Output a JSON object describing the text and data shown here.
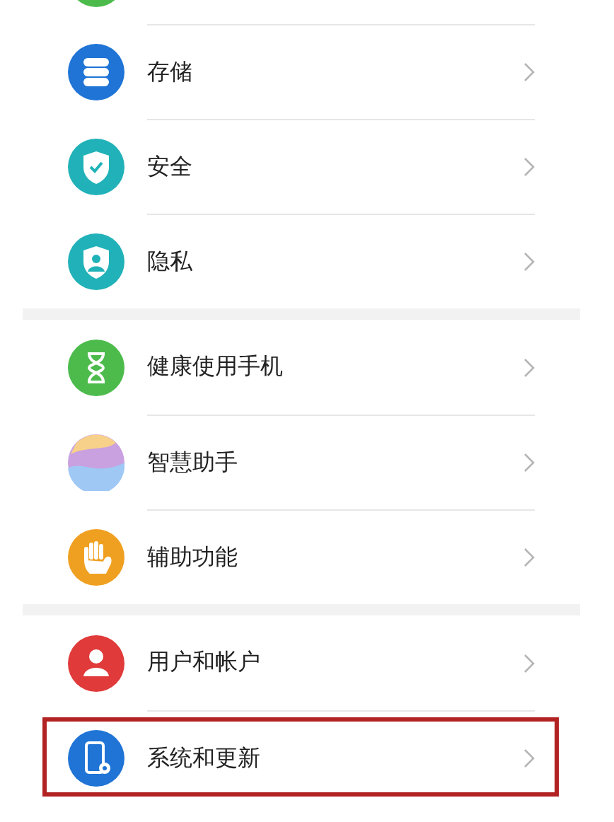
{
  "groups": [
    {
      "items": [
        {
          "kind": "cut",
          "color": "#4cbb4c"
        },
        {
          "kind": "row",
          "label": "存储",
          "color": "#1f74d6",
          "highlighted": false
        },
        {
          "kind": "row",
          "label": "安全",
          "color": "#20b2b8",
          "highlighted": false
        },
        {
          "kind": "row",
          "label": "隐私",
          "color": "#20b2b8",
          "highlighted": false
        }
      ]
    },
    {
      "items": [
        {
          "kind": "row",
          "label": "健康使用手机",
          "color": "#4cbb4c",
          "highlighted": false
        },
        {
          "kind": "row",
          "label": "智慧助手",
          "color": "#c9a0e0",
          "highlighted": false
        },
        {
          "kind": "row",
          "label": "辅助功能",
          "color": "#f0a020",
          "highlighted": false
        }
      ]
    },
    {
      "items": [
        {
          "kind": "row",
          "label": "用户和帐户",
          "color": "#e03a3a",
          "highlighted": false
        },
        {
          "kind": "row",
          "label": "系统和更新",
          "color": "#1f74d6",
          "highlighted": true
        }
      ]
    }
  ]
}
